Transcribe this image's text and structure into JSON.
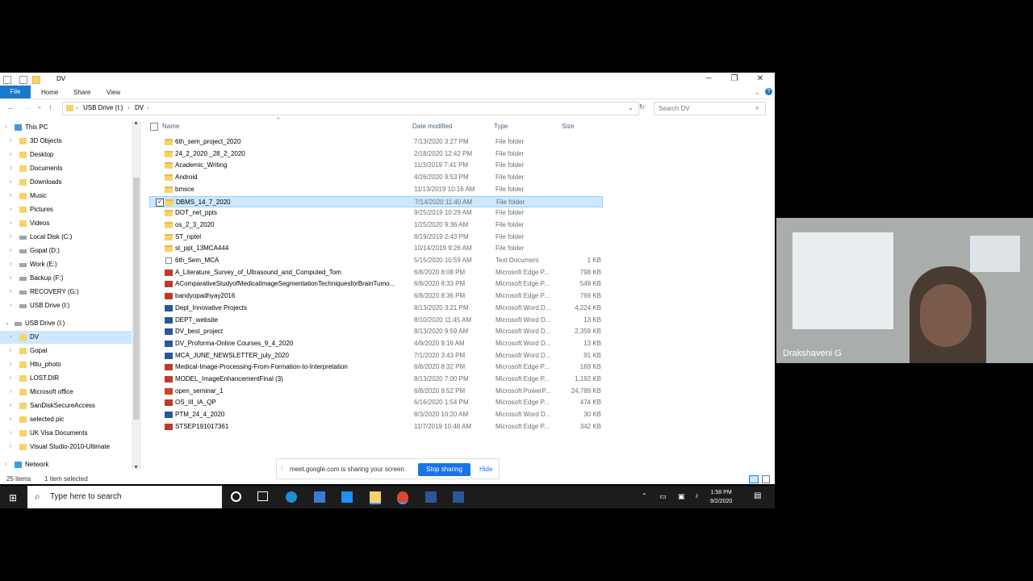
{
  "window": {
    "title": "DV",
    "controls": {
      "minimize": "─",
      "restore": "❐",
      "close": "✕"
    }
  },
  "ribbon": {
    "tabs": [
      "File",
      "Home",
      "Share",
      "View"
    ]
  },
  "address": {
    "path": [
      "USB Drive (I:)",
      "DV"
    ],
    "search_placeholder": "Search DV"
  },
  "nav": {
    "items": [
      {
        "label": "This PC",
        "icon": "pc-icon",
        "level": 0,
        "selected": false
      },
      {
        "label": "3D Objects",
        "icon": "folder-icon",
        "level": 1,
        "selected": false
      },
      {
        "label": "Desktop",
        "icon": "folder-icon",
        "level": 1,
        "selected": false
      },
      {
        "label": "Documents",
        "icon": "folder-icon",
        "level": 1,
        "selected": false
      },
      {
        "label": "Downloads",
        "icon": "folder-icon",
        "level": 1,
        "selected": false
      },
      {
        "label": "Music",
        "icon": "folder-icon",
        "level": 1,
        "selected": false
      },
      {
        "label": "Pictures",
        "icon": "folder-icon",
        "level": 1,
        "selected": false
      },
      {
        "label": "Videos",
        "icon": "folder-icon",
        "level": 1,
        "selected": false
      },
      {
        "label": "Local Disk (C:)",
        "icon": "drive-icon",
        "level": 1,
        "selected": false
      },
      {
        "label": "Gopal (D:)",
        "icon": "drive-icon",
        "level": 1,
        "selected": false
      },
      {
        "label": "Work (E:)",
        "icon": "drive-icon",
        "level": 1,
        "selected": false
      },
      {
        "label": "Backup (F:)",
        "icon": "drive-icon",
        "level": 1,
        "selected": false
      },
      {
        "label": "RECOVERY (G:)",
        "icon": "drive-icon",
        "level": 1,
        "selected": false
      },
      {
        "label": "USB Drive (I:)",
        "icon": "drive-icon",
        "level": 1,
        "selected": false
      },
      {
        "label": "USB Drive (I:)",
        "icon": "drive-icon",
        "level": 0,
        "selected": false,
        "gap": true
      },
      {
        "label": "DV",
        "icon": "folder-icon",
        "level": 1,
        "selected": true
      },
      {
        "label": "Gopal",
        "icon": "folder-icon",
        "level": 1,
        "selected": false
      },
      {
        "label": "Hltu_photo",
        "icon": "folder-icon",
        "level": 1,
        "selected": false
      },
      {
        "label": "LOST.DIR",
        "icon": "folder-icon",
        "level": 1,
        "selected": false
      },
      {
        "label": "Microsoft office",
        "icon": "folder-icon",
        "level": 1,
        "selected": false
      },
      {
        "label": "SanDiskSecureAccess",
        "icon": "folder-icon",
        "level": 1,
        "selected": false
      },
      {
        "label": "selected pic",
        "icon": "folder-icon",
        "level": 1,
        "selected": false
      },
      {
        "label": "UK Visa Documents",
        "icon": "folder-icon",
        "level": 1,
        "selected": false
      },
      {
        "label": "Visual Studio-2010-Ultimate",
        "icon": "folder-icon",
        "level": 1,
        "selected": false
      },
      {
        "label": "Network",
        "icon": "network-icon",
        "level": 0,
        "selected": false,
        "gap": true
      }
    ]
  },
  "list": {
    "columns": {
      "name": "Name",
      "date": "Date modified",
      "type": "Type",
      "size": "Size"
    },
    "rows": [
      {
        "name": "6th_sem_project_2020",
        "date": "7/13/2020 3:27 PM",
        "type": "File folder",
        "size": "",
        "kind": "folder"
      },
      {
        "name": "24_2_2020 _28_2_2020",
        "date": "2/18/2020 12:42 PM",
        "type": "File folder",
        "size": "",
        "kind": "folder"
      },
      {
        "name": "Academic_Writing",
        "date": "11/3/2019 7:41 PM",
        "type": "File folder",
        "size": "",
        "kind": "folder"
      },
      {
        "name": "Android",
        "date": "4/26/2020 9:53 PM",
        "type": "File folder",
        "size": "",
        "kind": "folder"
      },
      {
        "name": "bmsce",
        "date": "11/13/2019 10:16 AM",
        "type": "File folder",
        "size": "",
        "kind": "folder"
      },
      {
        "name": "DBMS_14_7_2020",
        "date": "7/14/2020 11:40 AM",
        "type": "File folder",
        "size": "",
        "kind": "folder",
        "selected": true
      },
      {
        "name": "DOT_net_ppts",
        "date": "9/25/2019 10:29 AM",
        "type": "File folder",
        "size": "",
        "kind": "folder"
      },
      {
        "name": "os_2_3_2020",
        "date": "1/25/2020 9:36 AM",
        "type": "File folder",
        "size": "",
        "kind": "folder"
      },
      {
        "name": "ST_nptel",
        "date": "8/19/2019 2:43 PM",
        "type": "File folder",
        "size": "",
        "kind": "folder"
      },
      {
        "name": "st_ppt_13MCA444",
        "date": "10/14/2019 9:26 AM",
        "type": "File folder",
        "size": "",
        "kind": "folder"
      },
      {
        "name": "6th_Sem_MCA",
        "date": "5/15/2020 10:59 AM",
        "type": "Text Document",
        "size": "1 KB",
        "kind": "txt"
      },
      {
        "name": "A_Literature_Survey_of_Ultrasound_and_Computed_Tom",
        "date": "6/8/2020 8:08 PM",
        "type": "Microsoft Edge P...",
        "size": "798 KB",
        "kind": "pdf"
      },
      {
        "name": "AComparativeStudyofMedicalImageSegmentationTechniquesforBrainTumo...",
        "date": "6/8/2020 8:33 PM",
        "type": "Microsoft Edge P...",
        "size": "549 KB",
        "kind": "pdf"
      },
      {
        "name": "bandyopadhyay2016",
        "date": "6/8/2020 8:36 PM",
        "type": "Microsoft Edge P...",
        "size": "769 KB",
        "kind": "pdf"
      },
      {
        "name": "Dept_Innovative Projects",
        "date": "8/13/2020 3:21 PM",
        "type": "Microsoft Word D...",
        "size": "4,224 KB",
        "kind": "word"
      },
      {
        "name": "DEPT_website",
        "date": "8/10/2020 11:45 AM",
        "type": "Microsoft Word D...",
        "size": "13 KB",
        "kind": "word"
      },
      {
        "name": "DV_best_project",
        "date": "8/13/2020 9:59 AM",
        "type": "Microsoft Word D...",
        "size": "2,359 KB",
        "kind": "word"
      },
      {
        "name": "DV_Proforma-Online Courses_9_4_2020",
        "date": "4/9/2020 9:16 AM",
        "type": "Microsoft Word D...",
        "size": "13 KB",
        "kind": "word"
      },
      {
        "name": "MCA_JUNE_NEWSLETTER_july_2020",
        "date": "7/1/2020 3:43 PM",
        "type": "Microsoft Word D...",
        "size": "91 KB",
        "kind": "word"
      },
      {
        "name": "Medical-Image-Processing-From-Formation-to-Interpretation",
        "date": "6/8/2020 8:32 PM",
        "type": "Microsoft Edge P...",
        "size": "169 KB",
        "kind": "pdf"
      },
      {
        "name": "MODEL_ImageEnhancementFinal (3)",
        "date": "8/13/2020 7:00 PM",
        "type": "Microsoft Edge P...",
        "size": "1,192 KB",
        "kind": "pdf"
      },
      {
        "name": "open_seminar_1",
        "date": "6/8/2020 9:52 PM",
        "type": "Microsoft PowerP...",
        "size": "24,789 KB",
        "kind": "ppt"
      },
      {
        "name": "OS_III_IA_QP",
        "date": "6/16/2020 1:54 PM",
        "type": "Microsoft Edge P...",
        "size": "474 KB",
        "kind": "pdf"
      },
      {
        "name": "PTM_24_4_2020",
        "date": "8/3/2020 10:20 AM",
        "type": "Microsoft Word D...",
        "size": "30 KB",
        "kind": "word"
      },
      {
        "name": "STSEP191017361",
        "date": "11/7/2019 10:48 AM",
        "type": "Microsoft Edge P...",
        "size": "342 KB",
        "kind": "pdf"
      }
    ]
  },
  "status": {
    "count": "25 items",
    "selected": "1 item selected"
  },
  "share_bar": {
    "message": "meet.google.com is sharing your screen.",
    "stop_label": "Stop sharing",
    "hide_label": "Hide"
  },
  "taskbar": {
    "search_placeholder": "Type here to search",
    "time": "1:58 PM",
    "date": "9/2/2020"
  },
  "video": {
    "participant_name": "Drakshaveni G"
  },
  "colors": {
    "accent": "#1979ca",
    "selection": "#cce8ff",
    "share_button": "#1a73e8"
  }
}
